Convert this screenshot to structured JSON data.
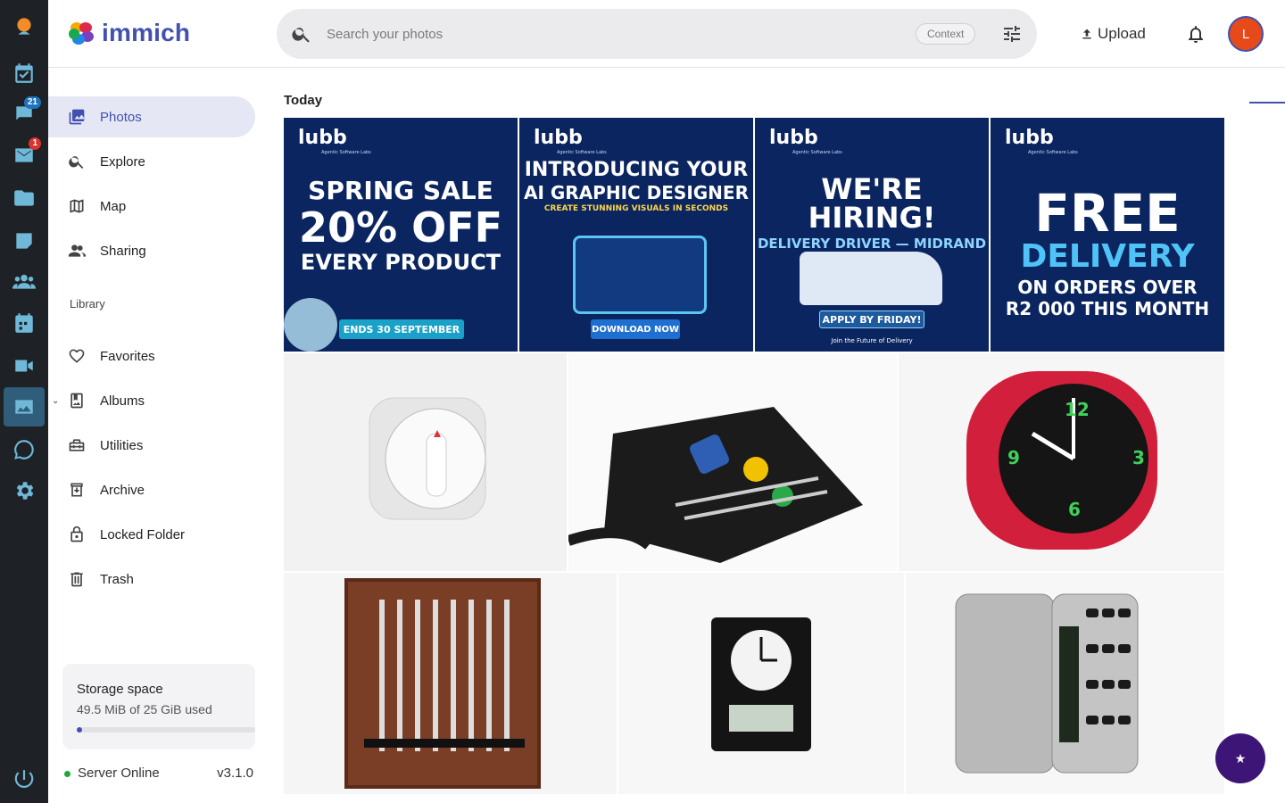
{
  "rail": {
    "items": [
      {
        "name": "profile-logo-icon"
      },
      {
        "name": "calendar-check-icon"
      },
      {
        "name": "chat-icon",
        "badge": "21"
      },
      {
        "name": "mail-icon",
        "badge": "1"
      },
      {
        "name": "folder-icon"
      },
      {
        "name": "note-icon"
      },
      {
        "name": "users-icon"
      },
      {
        "name": "calendar-icon"
      },
      {
        "name": "video-icon"
      },
      {
        "name": "photos-app-icon",
        "active": true
      },
      {
        "name": "whatsapp-icon"
      },
      {
        "name": "settings-icon"
      },
      {
        "name": "power-icon"
      }
    ]
  },
  "header": {
    "logo_text": "immich",
    "search_placeholder": "Search your photos",
    "context_chip": "Context",
    "upload_label": "Upload",
    "avatar_initial": "L"
  },
  "sidebar": {
    "items": [
      {
        "label": "Photos",
        "icon": "photos-icon",
        "active": true
      },
      {
        "label": "Explore",
        "icon": "search-icon"
      },
      {
        "label": "Map",
        "icon": "map-icon"
      },
      {
        "label": "Sharing",
        "icon": "people-icon"
      }
    ],
    "library_label": "Library",
    "library_items": [
      {
        "label": "Favorites",
        "icon": "heart-icon"
      },
      {
        "label": "Albums",
        "icon": "album-icon"
      },
      {
        "label": "Utilities",
        "icon": "toolbox-icon"
      },
      {
        "label": "Archive",
        "icon": "archive-icon"
      },
      {
        "label": "Locked Folder",
        "icon": "lock-icon"
      },
      {
        "label": "Trash",
        "icon": "trash-icon"
      }
    ],
    "storage": {
      "title": "Storage space",
      "used": "49.5 MiB of 25 GiB used",
      "fraction": 0.002
    },
    "server_status": "Server Online",
    "version": "v3.1.0"
  },
  "main": {
    "date_header": "Today",
    "promos": [
      {
        "brand": "lubb",
        "brand_sub": "Agentic Software Labs",
        "line1": "SPRING SALE",
        "line2": "20% OFF",
        "line3": "EVERY PRODUCT",
        "cta": "ENDS 30 SEPTEMBER"
      },
      {
        "brand": "lubb",
        "brand_sub": "Agentic Software Labs",
        "line1": "INTRODUCING YOUR",
        "line2": "AI GRAPHIC DESIGNER",
        "line3": "CREATE STUNNING VISUALS IN SECONDS",
        "cta": "DOWNLOAD NOW"
      },
      {
        "brand": "lubb",
        "brand_sub": "Agentic Software Labs",
        "line1": "WE'RE HIRING!",
        "line2": "DELIVERY DRIVER — MIDRAND",
        "line3": "Join the Future of Delivery",
        "cta": "APPLY BY FRIDAY!"
      },
      {
        "brand": "lubb",
        "brand_sub": "Agentic Software Labs",
        "line1": "FREE",
        "line2": "DELIVERY",
        "line3": "ON ORDERS OVER",
        "cta": "R2 000 THIS MONTH"
      }
    ],
    "products": [
      {
        "name": "kitchen-timer-photo"
      },
      {
        "name": "watch-repair-kit-photo"
      },
      {
        "name": "red-alarm-clock-photo"
      },
      {
        "name": "screwdriver-set-photo"
      },
      {
        "name": "desk-clock-photo"
      },
      {
        "name": "pocket-calculator-photo"
      }
    ]
  },
  "colors": {
    "accent": "#4250af",
    "rail_bg": "#1e2125",
    "rail_icon": "#6fb8d8",
    "avatar_bg": "#e64a19",
    "promo_bg": "#0a2560",
    "fab_bg": "#3d1577"
  }
}
